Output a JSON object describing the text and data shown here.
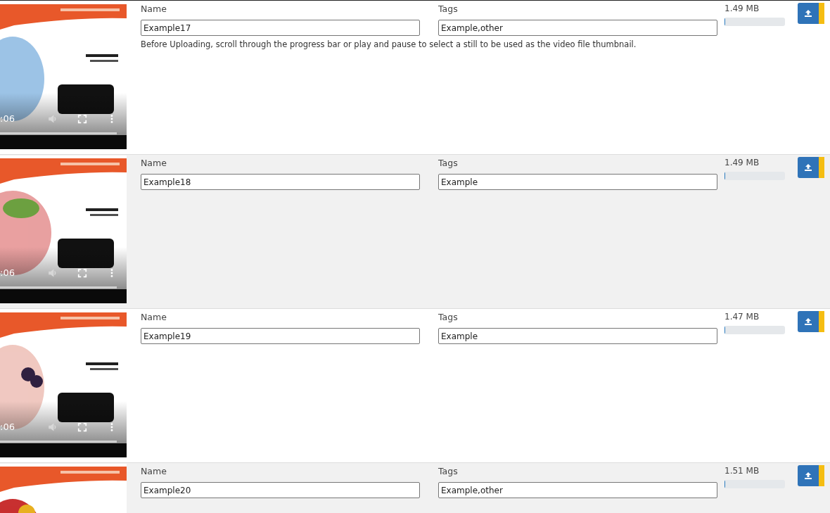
{
  "uploads": [
    {
      "video": {
        "time": ":06"
      },
      "name_label": "Name",
      "name_value": "Example17",
      "tags_label": "Tags",
      "tags_value": "Example,other",
      "hint": "Before Uploading, scroll through the progress bar or play and pause to select a still to be used as the video file thumbnail.",
      "size": "1.49 MB",
      "level": 0
    },
    {
      "video": {
        "time": ":06"
      },
      "name_label": "Name",
      "name_value": "Example18",
      "tags_label": "Tags",
      "tags_value": "Example",
      "size": "1.49 MB",
      "level": 0
    },
    {
      "video": {
        "time": ":06"
      },
      "name_label": "Name",
      "name_value": "Example19",
      "tags_label": "Tags",
      "tags_value": "Example",
      "size": "1.47 MB",
      "level": 0
    },
    {
      "name_label": "Name",
      "name_value": "Example20",
      "tags_label": "Tags",
      "tags_value": "Example,other",
      "size": "1.51 MB",
      "level": 0
    }
  ]
}
